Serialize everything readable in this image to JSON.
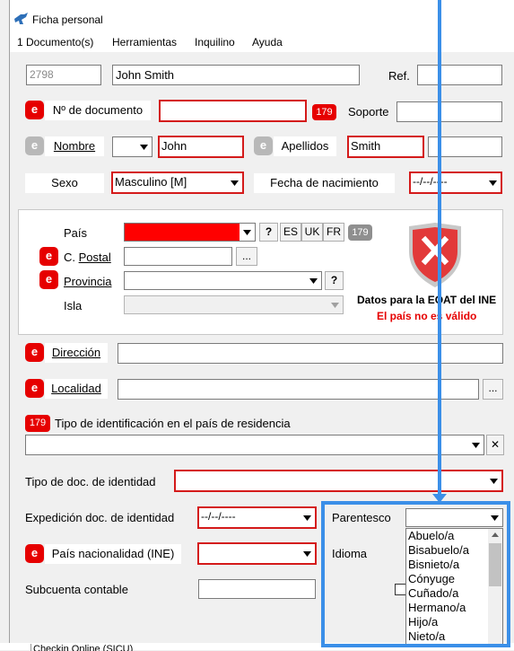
{
  "window": {
    "title": "Ficha personal"
  },
  "menu": [
    "1 Documento(s)",
    "Herramientas",
    "Inquilino",
    "Ayuda"
  ],
  "header": {
    "id_value": "2798",
    "name_value": "John Smith",
    "ref_label": "Ref.",
    "ref_value": ""
  },
  "row_doc": {
    "badge": "e",
    "label": "Nº de documento",
    "value": "",
    "count_badge": "179",
    "soporte_label": "Soporte",
    "soporte_value": ""
  },
  "row_nombre": {
    "badge": "e",
    "label": "Nombre",
    "title_value": "",
    "nombre_value": "John",
    "apellidos_badge": "e",
    "apellidos_label": "Apellidos",
    "apellido1_value": "Smith",
    "apellido2_value": ""
  },
  "row_sexo": {
    "sexo_label": "Sexo",
    "sexo_value": "Masculino [M]",
    "fecha_label": "Fecha de nacimiento",
    "fecha_value": "--/--/----"
  },
  "address_panel": {
    "pais_label": "País",
    "pais_help": "?",
    "lang_buttons": [
      "ES",
      "UK",
      "FR"
    ],
    "count_badge": "179",
    "cp_badge": "e",
    "cp_label": "C. Postal",
    "cp_value": "",
    "cp_button": "...",
    "provincia_badge": "e",
    "provincia_label": "Provincia",
    "provincia_help": "?",
    "isla_label": "Isla",
    "ine_title": "Datos para la EOAT del INE",
    "ine_error": "El país no es válido"
  },
  "row_direccion": {
    "badge": "e",
    "label": "Dirección",
    "value": ""
  },
  "row_localidad": {
    "badge": "e",
    "label": "Localidad",
    "value": "",
    "button": "..."
  },
  "row_tipo_id": {
    "badge": "179",
    "label": "Tipo de identificación en el país de residencia",
    "clear_button": "✕"
  },
  "row_tipo_doc": {
    "label": "Tipo de doc. de identidad"
  },
  "row_expedicion": {
    "label": "Expedición doc. de identidad",
    "value": "--/--/----",
    "parentesco_label": "Parentesco"
  },
  "row_nacionalidad": {
    "badge": "e",
    "label": "País nacionalidad (INE)",
    "idioma_label": "Idioma"
  },
  "row_subcuenta": {
    "label": "Subcuenta contable"
  },
  "parentesco_options": [
    "Abuelo/a",
    "Bisabuelo/a",
    "Bisnieto/a",
    "Cónyuge",
    "Cuñado/a",
    "Hermano/a",
    "Hijo/a",
    "Nieto/a"
  ],
  "bottom_tab": "Checkin Online (SICU)",
  "colors": {
    "error_red": "#e60000",
    "highlight_blue": "#3b8fe8"
  }
}
